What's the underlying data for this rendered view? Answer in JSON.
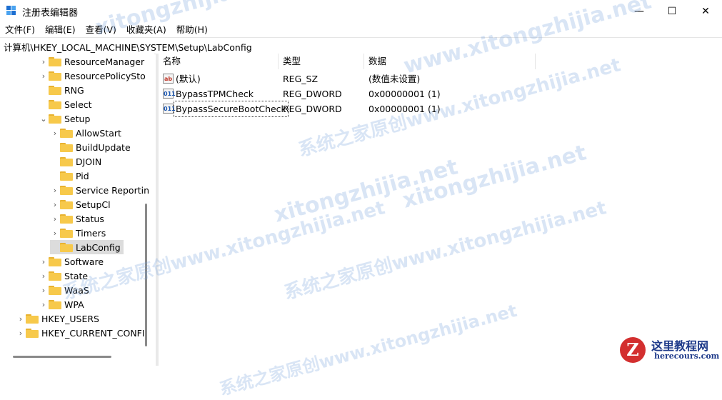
{
  "window": {
    "title": "注册表编辑器",
    "minimize_glyph": "—",
    "maximize_glyph": "☐",
    "close_glyph": "✕"
  },
  "menu": [
    "文件(F)",
    "编辑(E)",
    "查看(V)",
    "收藏夹(A)",
    "帮助(H)"
  ],
  "address": "计算机\\HKEY_LOCAL_MACHINE\\SYSTEM\\Setup\\LabConfig",
  "tree": [
    {
      "label": "ResourceManager",
      "level": 2,
      "expander": "›"
    },
    {
      "label": "ResourcePolicySto",
      "level": 2,
      "expander": "›"
    },
    {
      "label": "RNG",
      "level": 2,
      "expander": ""
    },
    {
      "label": "Select",
      "level": 2,
      "expander": ""
    },
    {
      "label": "Setup",
      "level": 2,
      "expander": "⌄"
    },
    {
      "label": "AllowStart",
      "level": 3,
      "expander": "›"
    },
    {
      "label": "BuildUpdate",
      "level": 3,
      "expander": ""
    },
    {
      "label": "DJOIN",
      "level": 3,
      "expander": ""
    },
    {
      "label": "Pid",
      "level": 3,
      "expander": ""
    },
    {
      "label": "Service Reportin",
      "level": 3,
      "expander": "›"
    },
    {
      "label": "SetupCl",
      "level": 3,
      "expander": "›"
    },
    {
      "label": "Status",
      "level": 3,
      "expander": "›"
    },
    {
      "label": "Timers",
      "level": 3,
      "expander": "›"
    },
    {
      "label": "LabConfig",
      "level": 3,
      "expander": "",
      "selected": true
    },
    {
      "label": "Software",
      "level": 2,
      "expander": "›"
    },
    {
      "label": "State",
      "level": 2,
      "expander": "›"
    },
    {
      "label": "WaaS",
      "level": 2,
      "expander": "›"
    },
    {
      "label": "WPA",
      "level": 2,
      "expander": "›"
    },
    {
      "label": "HKEY_USERS",
      "level": 0,
      "expander": "›"
    },
    {
      "label": "HKEY_CURRENT_CONFI",
      "level": 0,
      "expander": "›"
    }
  ],
  "columns": {
    "name": "名称",
    "type": "类型",
    "data": "数据"
  },
  "values": [
    {
      "icon": "ab",
      "name": "(默认)",
      "type": "REG_SZ",
      "data": "(数值未设置)"
    },
    {
      "icon": "011",
      "name": "BypassTPMCheck",
      "type": "REG_DWORD",
      "data": "0x00000001 (1)"
    },
    {
      "icon": "011",
      "name": "BypassSecureBootCheck",
      "type": "REG_DWORD",
      "data": "0x00000001 (1)"
    }
  ],
  "watermarks": [
    "xitongzhijia.net",
    "www.xitongzhijia.net",
    "系统之家原创www.xitongzhijia.net",
    "xitongzhijia.net",
    "系统之家原创www.xitongzhijia.net",
    "系统之家原创www.xitongzhijia.net",
    "xitongzhijia.net",
    "系统之家原创www.xitongzhijia.net"
  ],
  "logo": {
    "letter": "Z",
    "title": "这里教程网",
    "subtitle": "herecours.com"
  }
}
